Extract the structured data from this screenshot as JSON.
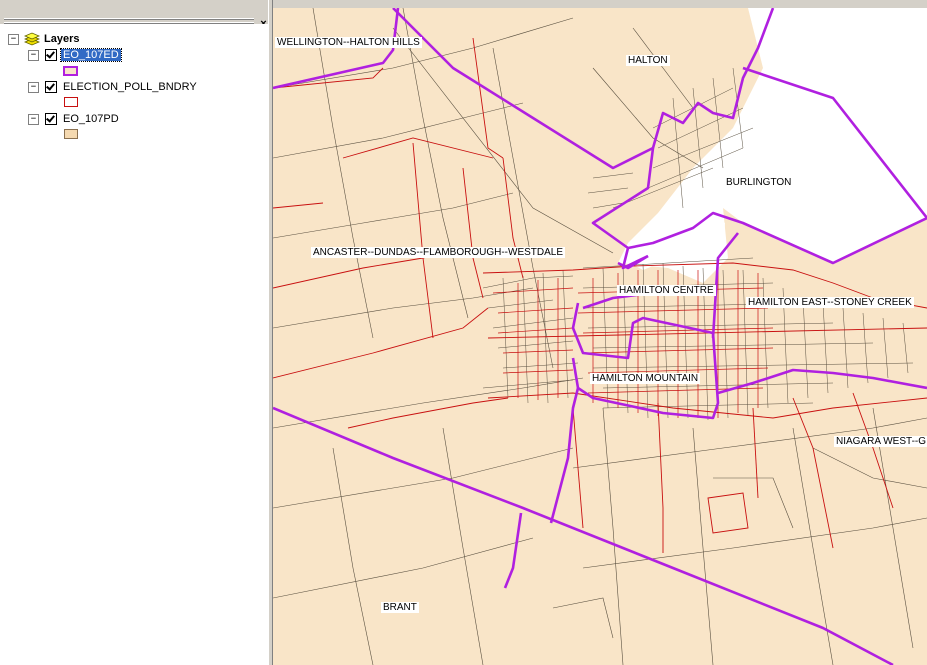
{
  "toc": {
    "root_label": "Layers",
    "close_glyph": "×",
    "layers": [
      {
        "name": "EO_107ED",
        "checked": true,
        "selected": true,
        "symbol": "purple-outline"
      },
      {
        "name": "ELECTION_POLL_BNDRY",
        "checked": true,
        "selected": false,
        "symbol": "red-outline"
      },
      {
        "name": "EO_107PD",
        "checked": true,
        "selected": false,
        "symbol": "tan-fill"
      }
    ]
  },
  "map": {
    "colors": {
      "land": "#f9e5c8",
      "water": "#ffffff",
      "ed_boundary": "#b020e0",
      "poll_boundary": "#c81010",
      "pd_boundary": "#5a5040"
    },
    "labels": [
      {
        "text": "WELLINGTON--HALTON HILLS"
      },
      {
        "text": "HALTON"
      },
      {
        "text": "BURLINGTON"
      },
      {
        "text": "ANCASTER--DUNDAS--FLAMBOROUGH--WESTDALE"
      },
      {
        "text": "HAMILTON CENTRE"
      },
      {
        "text": "HAMILTON EAST--STONEY CREEK"
      },
      {
        "text": "HAMILTON MOUNTAIN"
      },
      {
        "text": "NIAGARA WEST--G"
      },
      {
        "text": "BRANT"
      }
    ]
  }
}
